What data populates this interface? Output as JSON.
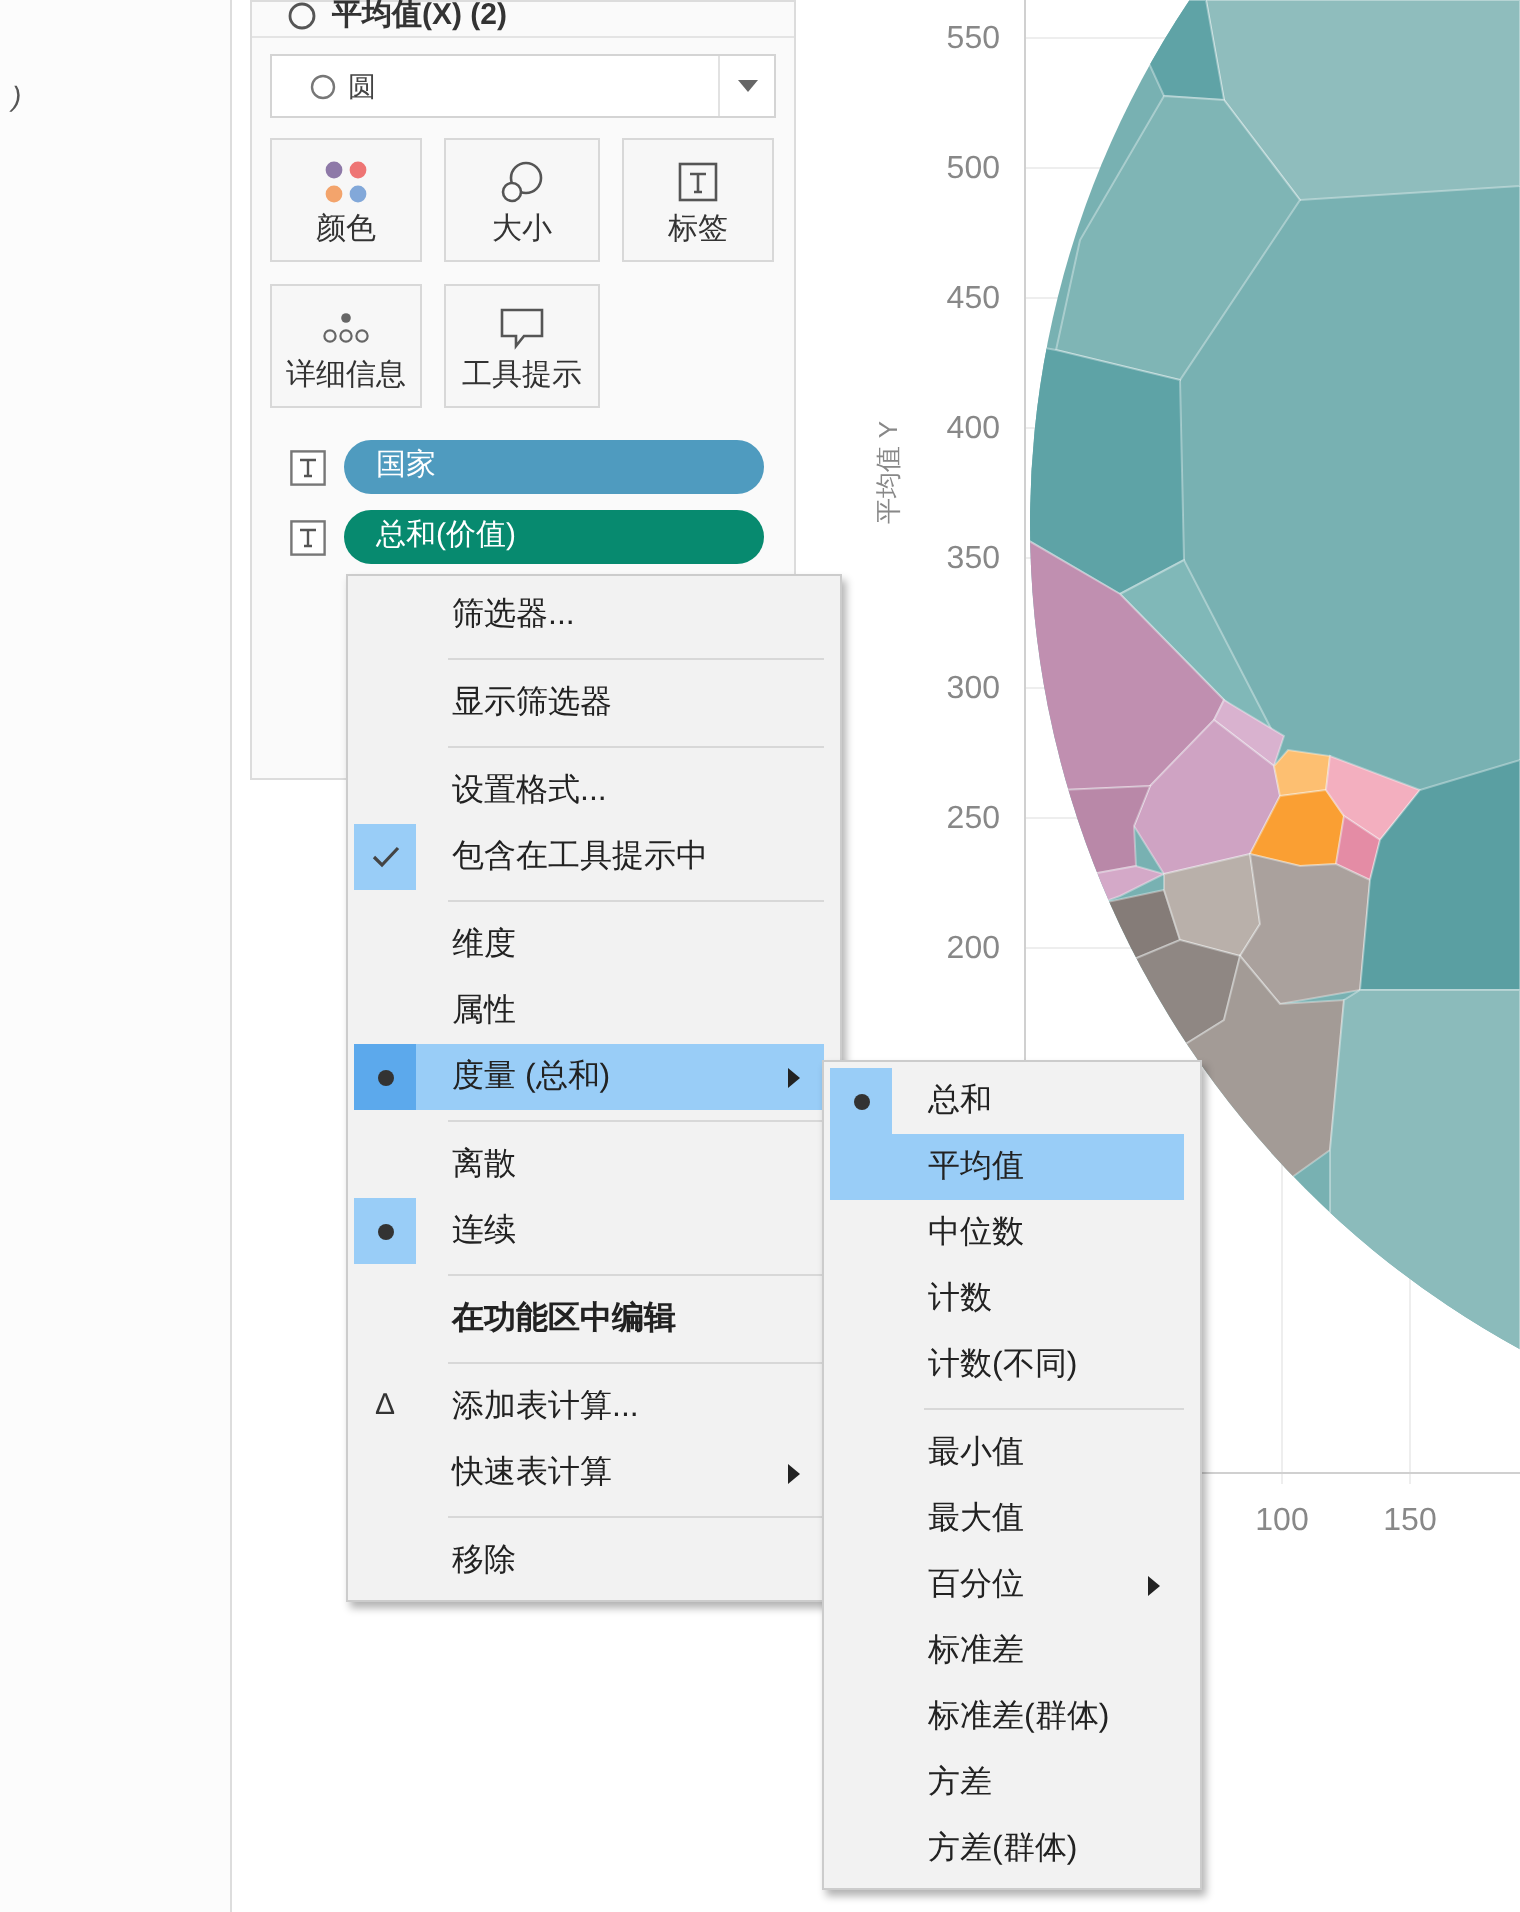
{
  "left_panel": {
    "text": ")"
  },
  "marks_card": {
    "title": "平均值(X) (2)",
    "mark_type": "圆",
    "buttons": [
      {
        "label": "颜色",
        "kind": "color"
      },
      {
        "label": "大小",
        "kind": "size"
      },
      {
        "label": "标签",
        "kind": "label"
      },
      {
        "label": "详细信息",
        "kind": "detail"
      },
      {
        "label": "工具提示",
        "kind": "tooltip"
      }
    ],
    "pills": [
      {
        "label": "国家",
        "color": "#4f9bbf"
      },
      {
        "label": "总和(价值)",
        "color": "#078a6f"
      }
    ]
  },
  "chart": {
    "y_axis_title": "平均值 Y",
    "y_ticks": [
      "550",
      "500",
      "450",
      "400",
      "350",
      "300",
      "250",
      "200"
    ],
    "x_ticks": [
      "100",
      "150"
    ]
  },
  "context_menu": {
    "items": [
      {
        "kind": "item",
        "label": "筛选器...",
        "selected": false,
        "checked": false
      },
      {
        "kind": "separator"
      },
      {
        "kind": "item",
        "label": "显示筛选器",
        "selected": false,
        "checked": false
      },
      {
        "kind": "separator"
      },
      {
        "kind": "item",
        "label": "设置格式...",
        "selected": false,
        "checked": false
      },
      {
        "kind": "check",
        "label": "包含在工具提示中",
        "selected": false,
        "checked": true
      },
      {
        "kind": "separator"
      },
      {
        "kind": "item",
        "label": "维度",
        "selected": false,
        "checked": false
      },
      {
        "kind": "item",
        "label": "属性",
        "selected": false,
        "checked": false
      },
      {
        "kind": "radio",
        "label": "度量 (总和)",
        "selected": true,
        "checked": true,
        "submenu": true
      },
      {
        "kind": "separator"
      },
      {
        "kind": "item",
        "label": "离散",
        "selected": false,
        "checked": false
      },
      {
        "kind": "radio",
        "label": "连续",
        "selected": false,
        "checked": true
      },
      {
        "kind": "separator"
      },
      {
        "kind": "item",
        "label": "在功能区中编辑",
        "selected": false,
        "checked": false,
        "bold": true
      },
      {
        "kind": "separator"
      },
      {
        "kind": "item",
        "label": "添加表计算...",
        "selected": false,
        "checked": false,
        "prefix": "Δ"
      },
      {
        "kind": "item",
        "label": "快速表计算",
        "selected": false,
        "checked": false,
        "submenu": true
      },
      {
        "kind": "separator"
      },
      {
        "kind": "item",
        "label": "移除",
        "selected": false,
        "checked": false
      }
    ]
  },
  "submenu": {
    "items": [
      {
        "kind": "radio",
        "label": "总和",
        "selected": false,
        "checked": true
      },
      {
        "kind": "item",
        "label": "平均值",
        "selected": true,
        "checked": false
      },
      {
        "kind": "item",
        "label": "中位数",
        "selected": false,
        "checked": false
      },
      {
        "kind": "item",
        "label": "计数",
        "selected": false,
        "checked": false
      },
      {
        "kind": "item",
        "label": "计数(不同)",
        "selected": false,
        "checked": false
      },
      {
        "kind": "separator"
      },
      {
        "kind": "item",
        "label": "最小值",
        "selected": false,
        "checked": false
      },
      {
        "kind": "item",
        "label": "最大值",
        "selected": false,
        "checked": false
      },
      {
        "kind": "item",
        "label": "百分位",
        "selected": false,
        "checked": false,
        "submenu": true
      },
      {
        "kind": "item",
        "label": "标准差",
        "selected": false,
        "checked": false
      },
      {
        "kind": "item",
        "label": "标准差(群体)",
        "selected": false,
        "checked": false
      },
      {
        "kind": "item",
        "label": "方差",
        "selected": false,
        "checked": false
      },
      {
        "kind": "item",
        "label": "方差(群体)",
        "selected": false,
        "checked": false
      }
    ]
  }
}
